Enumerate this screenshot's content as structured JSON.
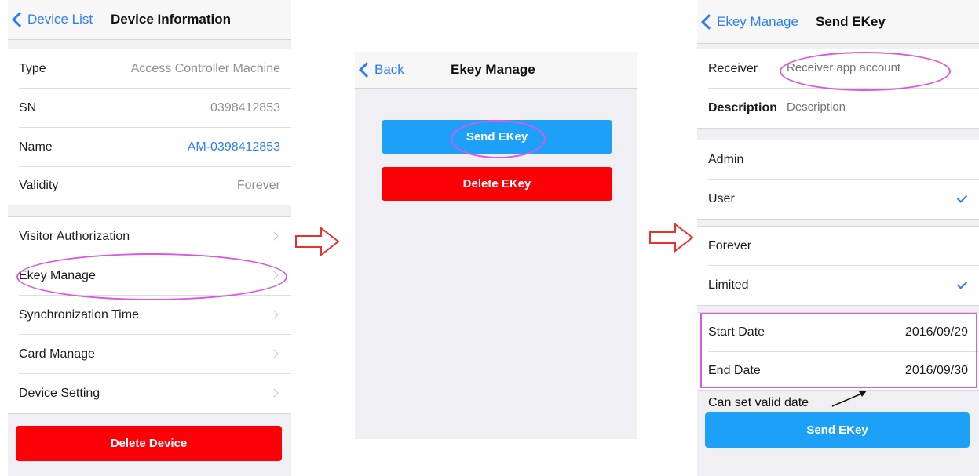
{
  "screen1": {
    "back_label": "Device List",
    "title": "Device Information",
    "info_rows": [
      {
        "label": "Type",
        "value": "Access Controller Machine"
      },
      {
        "label": "SN",
        "value": "0398412853"
      },
      {
        "label": "Name",
        "value": "AM-0398412853"
      },
      {
        "label": "Validity",
        "value": "Forever"
      }
    ],
    "menu_rows": [
      {
        "label": "Visitor Authorization"
      },
      {
        "label": "Ekey Manage"
      },
      {
        "label": "Synchronization Time"
      },
      {
        "label": "Card Manage"
      },
      {
        "label": "Device Setting"
      }
    ],
    "delete_button": "Delete Device"
  },
  "screen2": {
    "back_label": "Back",
    "title": "Ekey Manage",
    "send_button": "Send EKey",
    "delete_button": "Delete EKey"
  },
  "screen3": {
    "back_label": "Ekey Manage",
    "title": "Send EKey",
    "receiver_label": "Receiver",
    "receiver_placeholder": "Receiver app account",
    "description_label": "Description",
    "description_placeholder": "Description",
    "role_rows": [
      {
        "label": "Admin",
        "checked": false
      },
      {
        "label": "User",
        "checked": true
      }
    ],
    "validity_rows": [
      {
        "label": "Forever",
        "checked": false
      },
      {
        "label": "Limited",
        "checked": true
      }
    ],
    "start_date_label": "Start Date",
    "start_date_value": "2016/09/29",
    "end_date_label": "End Date",
    "end_date_value": "2016/09/30",
    "annotation": "Can set valid date",
    "send_button": "Send EKey"
  },
  "colors": {
    "accent": "#2d7df6",
    "highlight": "#d85ae0",
    "danger": "#fb0007",
    "primary_button": "#1da0f8",
    "arrow": "#e8322b"
  }
}
